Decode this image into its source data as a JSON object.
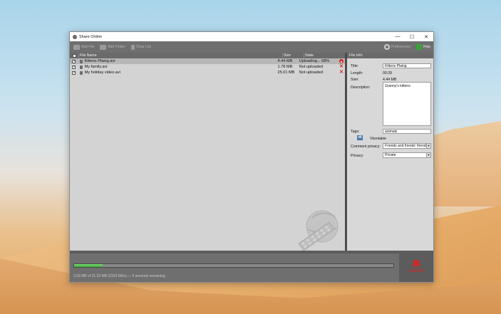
{
  "window": {
    "title": "Share Online",
    "minimize": "—",
    "maximize": "☐",
    "close": "✕"
  },
  "toolbar": {
    "add_file": "Add File",
    "add_folder": "Add Folder",
    "clear_list": "Clear List",
    "preferences": "Preferences",
    "help": "Help"
  },
  "list": {
    "headers": {
      "name": "File Name",
      "size": "Size",
      "state": "State"
    },
    "rows": [
      {
        "name": "Kittens Plaing.avi",
        "size": "4.44 MB",
        "state": "Uploading... 68%",
        "action_icon": "stop-icon",
        "checked": true,
        "selected": true
      },
      {
        "name": "My family.avi",
        "size": "1.78 MB",
        "state": "Not uploaded",
        "action_icon": "remove-icon",
        "checked": true,
        "selected": false
      },
      {
        "name": "My holiday video.avi",
        "size": "25.01 MB",
        "state": "Not uploaded",
        "action_icon": "remove-icon",
        "checked": true,
        "selected": false
      }
    ]
  },
  "info": {
    "header": "File Info",
    "title_label": "Title:",
    "title_value": "Kittens Plaing",
    "length_label": "Length:",
    "length_value": "00:29",
    "size_label": "Size:",
    "size_value": "4.44 MB",
    "description_label": "Description:",
    "description_value": "Granny's kittens",
    "tags_label": "Tags:",
    "tags_value": "animals",
    "service_name": "Vkontakte",
    "comment_privacy_label": "Comment privacy:",
    "comment_privacy_value": "Friends and friends' friends",
    "privacy_label": "Privacy:",
    "privacy_value": "Private"
  },
  "progress": {
    "fraction": 0.09,
    "status_text": "3.03 MB of 31.22 MB (3103 KB/s) — 9 seconds remaining"
  },
  "cancel": {
    "label": "Cancel"
  },
  "colors": {
    "progress_fill": "#3aaa36",
    "cancel": "#e02020",
    "toolbar": "#6f6f6f"
  }
}
